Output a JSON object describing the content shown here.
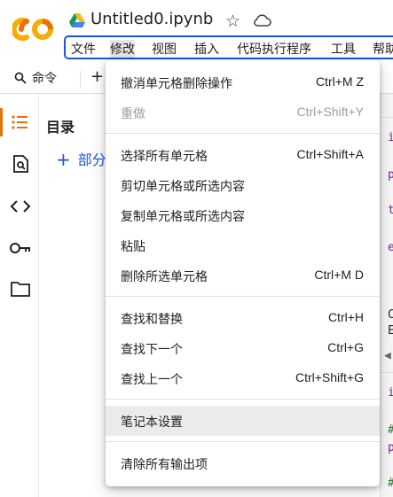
{
  "header": {
    "title": "Untitled0.ipynb",
    "logo_text": "CO",
    "accent": "#f9ab00",
    "logo_orange": "#e8710a"
  },
  "menubar": {
    "items": [
      "文件",
      "修改",
      "视图",
      "插入",
      "代码执行程序",
      "工具",
      "帮助"
    ],
    "active": "修改",
    "outline_color": "#1a56db"
  },
  "toolbar": {
    "command_label": "命令",
    "add_label": "+"
  },
  "sidebar": {
    "icons": [
      "list-icon",
      "document-search-icon",
      "code-brackets-icon",
      "key-icon",
      "folder-icon"
    ]
  },
  "toc": {
    "title": "目录",
    "add_section": "部分"
  },
  "code_peek": [
    "i",
    "p",
    "t",
    "e",
    "C",
    "E",
    "◀",
    "i",
    "#",
    "p",
    "#"
  ],
  "edit_menu": {
    "items": [
      {
        "label": "撤消单元格删除操作",
        "shortcut": "Ctrl+M Z",
        "disabled": false
      },
      {
        "label": "重做",
        "shortcut": "Ctrl+Shift+Y",
        "disabled": true
      },
      {
        "label": "选择所有单元格",
        "shortcut": "Ctrl+Shift+A",
        "disabled": false
      },
      {
        "label": "剪切单元格或所选内容",
        "shortcut": "",
        "disabled": false
      },
      {
        "label": "复制单元格或所选内容",
        "shortcut": "",
        "disabled": false
      },
      {
        "label": "粘贴",
        "shortcut": "",
        "disabled": false
      },
      {
        "label": "删除所选单元格",
        "shortcut": "Ctrl+M D",
        "disabled": false
      },
      {
        "label": "查找和替换",
        "shortcut": "Ctrl+H",
        "disabled": false
      },
      {
        "label": "查找下一个",
        "shortcut": "Ctrl+G",
        "disabled": false
      },
      {
        "label": "查找上一个",
        "shortcut": "Ctrl+Shift+G",
        "disabled": false
      },
      {
        "label": "笔记本设置",
        "shortcut": "",
        "disabled": false,
        "hovered": true
      },
      {
        "label": "清除所有输出项",
        "shortcut": "",
        "disabled": false
      }
    ]
  }
}
